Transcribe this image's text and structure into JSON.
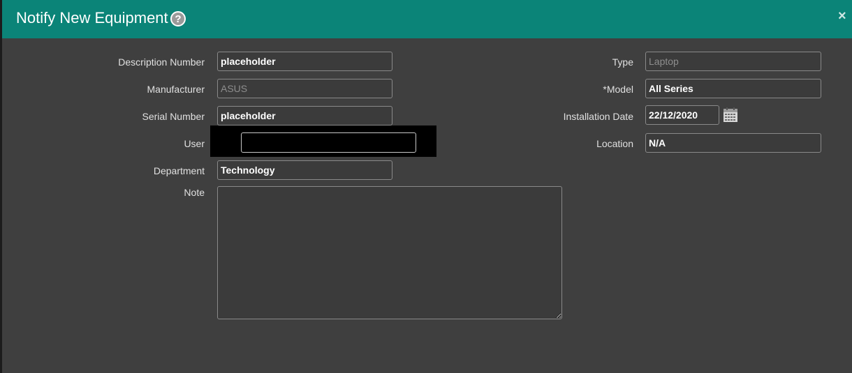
{
  "dialog": {
    "title": "Notify New Equipment",
    "help_icon_glyph": "?",
    "close_icon_glyph": "×"
  },
  "form": {
    "description_number": {
      "label": "Description Number",
      "value": "placeholder"
    },
    "manufacturer": {
      "label": "Manufacturer",
      "value": "ASUS"
    },
    "serial_number": {
      "label": "Serial Number",
      "value": "placeholder"
    },
    "user": {
      "label": "User",
      "value": ""
    },
    "department": {
      "label": "Department",
      "value": "Technology"
    },
    "note": {
      "label": "Note",
      "value": ""
    },
    "type": {
      "label": "Type",
      "value": "Laptop"
    },
    "model": {
      "label": "*Model",
      "value": "All Series"
    },
    "installation_date": {
      "label": "Installation Date",
      "value": "22/12/2020"
    },
    "location": {
      "label": "Location",
      "value": "N/A"
    }
  },
  "colors": {
    "header": "#0b8478",
    "body": "#3f3f3f"
  }
}
